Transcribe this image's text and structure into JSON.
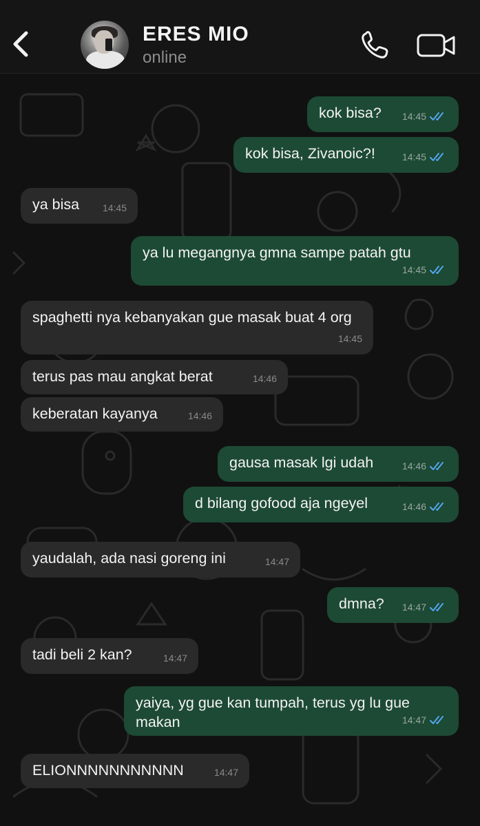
{
  "header": {
    "contact_name": "ERES MIO",
    "status": "online"
  },
  "colors": {
    "outgoing_bubble": "#1d4a35",
    "incoming_bubble": "#2a2a2a",
    "read_ticks": "#53a6f0",
    "background": "#111111"
  },
  "icons": [
    "back-chevron-icon",
    "avatar",
    "phone-call-icon",
    "video-call-icon",
    "double-check-read-icon"
  ],
  "messages": [
    {
      "dir": "out",
      "text": "kok bisa?",
      "time": "14:45",
      "read": true
    },
    {
      "dir": "out",
      "text": "kok bisa, Zivanoic?!",
      "time": "14:45",
      "read": true
    },
    {
      "dir": "in",
      "text": "ya bisa",
      "time": "14:45"
    },
    {
      "dir": "out",
      "text": "ya lu megangnya gmna sampe patah gtu",
      "time": "14:45",
      "read": true
    },
    {
      "dir": "in",
      "text": "spaghetti nya kebanyakan gue masak buat 4 org",
      "time": "14:45"
    },
    {
      "dir": "in",
      "text": "terus pas mau angkat berat",
      "time": "14:46"
    },
    {
      "dir": "in",
      "text": "keberatan kayanya",
      "time": "14:46"
    },
    {
      "dir": "out",
      "text": "gausa masak lgi udah",
      "time": "14:46",
      "read": true
    },
    {
      "dir": "out",
      "text": "d bilang gofood aja ngeyel",
      "time": "14:46",
      "read": true
    },
    {
      "dir": "in",
      "text": "yaudalah, ada nasi goreng ini",
      "time": "14:47"
    },
    {
      "dir": "out",
      "text": "dmna?",
      "time": "14:47",
      "read": true
    },
    {
      "dir": "in",
      "text": "tadi beli 2 kan?",
      "time": "14:47"
    },
    {
      "dir": "out",
      "text": "yaiya, yg gue kan tumpah, terus yg lu gue makan",
      "time": "14:47",
      "read": true
    },
    {
      "dir": "in",
      "text": "ELIONNNNNNNNNNN",
      "time": "14:47"
    }
  ]
}
